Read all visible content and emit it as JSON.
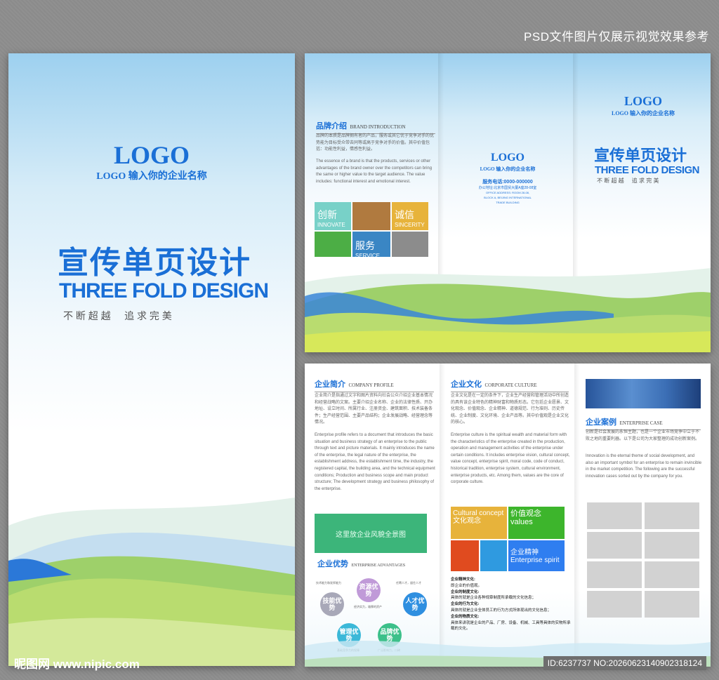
{
  "top_note": "PSD文件图片仅展示视觉效果参考",
  "cover": {
    "logo": "LOGO",
    "logo_sub": "LOGO 输入你的企业名称",
    "title_cn": "宣传单页设计",
    "title_en": "THREE FOLD DESIGN",
    "slogan": "不 断 超 越     追 求 完 美"
  },
  "outer": {
    "brand_title_cn": "品牌介绍",
    "brand_title_en": "BRAND INTRODUCTION",
    "brand_text_cn": "品牌的本质是品牌拥有者的产品，服务或其它优于竞争对手的优势能为目标受众带去同等或高于竞争对手的价值。其中价值包括：功能性利益，情感性利益。",
    "brand_text_en": "The essence of a brand is that the products, services or other advantages of the brand owner over the competitors can bring the same or higher value to the target audience. The value includes: functional interest and emotional interest.",
    "tiles": [
      {
        "cn": "创新",
        "en": "INNOVATE"
      },
      {
        "cn": "诚信",
        "en": "SINCERITY"
      },
      {
        "cn": "服务",
        "en": "SERVICE"
      }
    ],
    "mid_logo": "LOGO",
    "mid_logo_sub": "LOGO 输入你的企业名称",
    "phone": "服务电话:0000-000000",
    "address_cn": "办公地址:北京市国贸大厦A座28-08室",
    "address_en_1": "OFFICE ADDRESS: ROOM 28-08,",
    "address_en_2": "BLOCK A, BEIJING INTERNATIONAL",
    "address_en_3": "TRADE BUILDING",
    "right_logo": "LOGO",
    "right_logo_sub": "LOGO 输入你的企业名称",
    "right_title_cn": "宣传单页设计",
    "right_title_en": "THREE FOLD DESIGN",
    "right_slogan": "不 断 超 越     追 求 完 美"
  },
  "inner": {
    "profile_cn": "企业简介",
    "profile_en": "COMPANY PROFILE",
    "profile_text_cn": "企业简介是指通过文字和图片资料向社会公众介绍企业基本情况和经营战略的文案。主要介绍企业名称、企业的法律性质、开办地址、设立时间、所属行业、注册资金、建筑面积、技术装备条件；生产经营范围、主要产品结构；企业发展战略、经营理念等情况。",
    "profile_text_en": "Enterprise profile refers to a document that introduces the basic situation and business strategy of an enterprise to the public through text and picture materials. It mainly introduces the name of the enterprise, the legal nature of the enterprise, the establishment address, the establishment time, the industry, the registered capital, the building area, and the technical equipment conditions; Production and business scope and main product structure; The development strategy and business philosophy of the enterprise.",
    "panorama": "这里放企业风貌全景图",
    "adv_cn": "企业优势",
    "adv_en": "ENTERPRISE ADVANTAGES",
    "adv_notes": [
      "技术能力和发挥能力",
      "经济实力，雄厚的资产",
      "任聘人才，留住人才",
      "基础竞争力的保障",
      "广泛影响力，口碑"
    ],
    "hexes": [
      "技能优势",
      "资源优势",
      "人才优势",
      "管理优势",
      "品牌优势"
    ],
    "culture_cn": "企业文化",
    "culture_en": "CORPORATE CULTURE",
    "culture_text_cn": "企业文化是在一定的条件下，企业生产经营和管理活动中所创造的具有该企业特色的精神财富和物质形态。它包括企业愿景、文化观念、价值观念、企业精神、道德规范、行为准则、历史传统、企业制度、文化环境、企业产品等。其中价值观是企业文化的核心。",
    "culture_text_en": "Enterprise culture is the spiritual wealth and material form with the characteristics of the enterprise created in the production, operation and management activities of the enterprise under certain conditions. It includes enterprise vision, cultural concept, value concept, enterprise spirit, moral code, code of conduct, historical tradition, enterprise system, cultural environment, enterprise products, etc. Among them, values are the core of corporate culture.",
    "culture_tiles": [
      {
        "en": "Cultural concept",
        "cn": "文化观念"
      },
      {
        "cn": "价值观念",
        "en": "values"
      },
      {
        "cn": "企业精神",
        "en": "Enterprise spirit"
      }
    ],
    "culture_list": [
      {
        "h": "企业精神文化:",
        "t": "即企业的价值观。"
      },
      {
        "h": "企业的制度文化:",
        "t": "具体的就是企业各种规章制度所承载的文化信息；"
      },
      {
        "h": "企业的行为文化:",
        "t": "具体的就是企业全体员工的行为方式所体现出的文化信息；"
      },
      {
        "h": "企业的物质文化:",
        "t": "具体来讲就是企业的产品、厂房、设备、机械、工具等具体的实物所承载的文化。"
      }
    ],
    "case_cn": "企业案例",
    "case_en": "ENTERPRISE CASE",
    "case_text_cn": "创新是社会发展的永恒主题，也是一个企业市场竞争中立于不败之地的重要利器。以下是公司为大家整理的成功创新案例。",
    "case_text_en": "Innovation is the eternal theme of social development, and also an important symbol for an enterprise to remain invincible in the market competition. The following are the successful innovation cases sorted out by the company for you."
  },
  "watermark": "昵图网 www.nipic.com",
  "id_text": "ID:6237737 NO:20260623140902318124"
}
